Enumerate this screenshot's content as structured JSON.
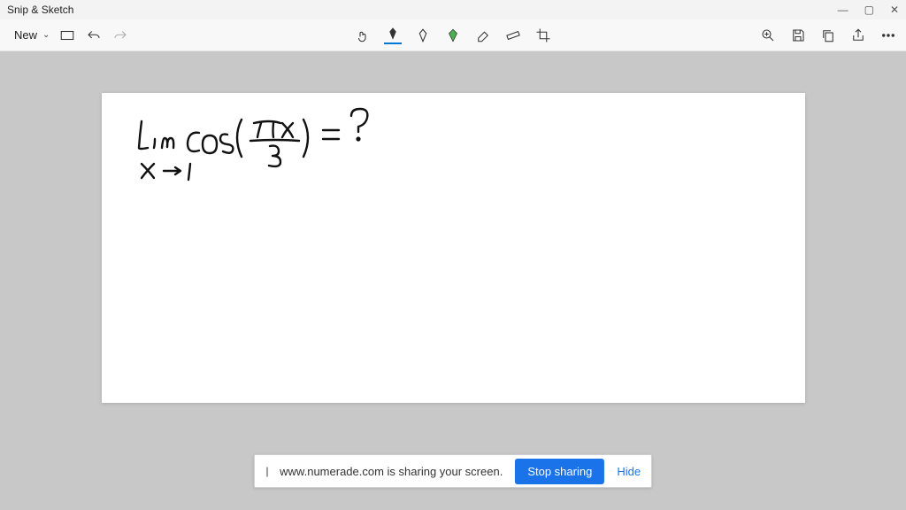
{
  "window": {
    "title": "Snip & Sketch",
    "minimize": "—",
    "maximize": "▢",
    "close": "✕"
  },
  "toolbar": {
    "new_label": "New",
    "chevron": "⌄"
  },
  "share_bar": {
    "message": "www.numerade.com is sharing your screen.",
    "stop_label": "Stop sharing",
    "hide_label": "Hide"
  },
  "handwriting": {
    "content": "Lim cos(πx/3) = ?  x→1"
  }
}
